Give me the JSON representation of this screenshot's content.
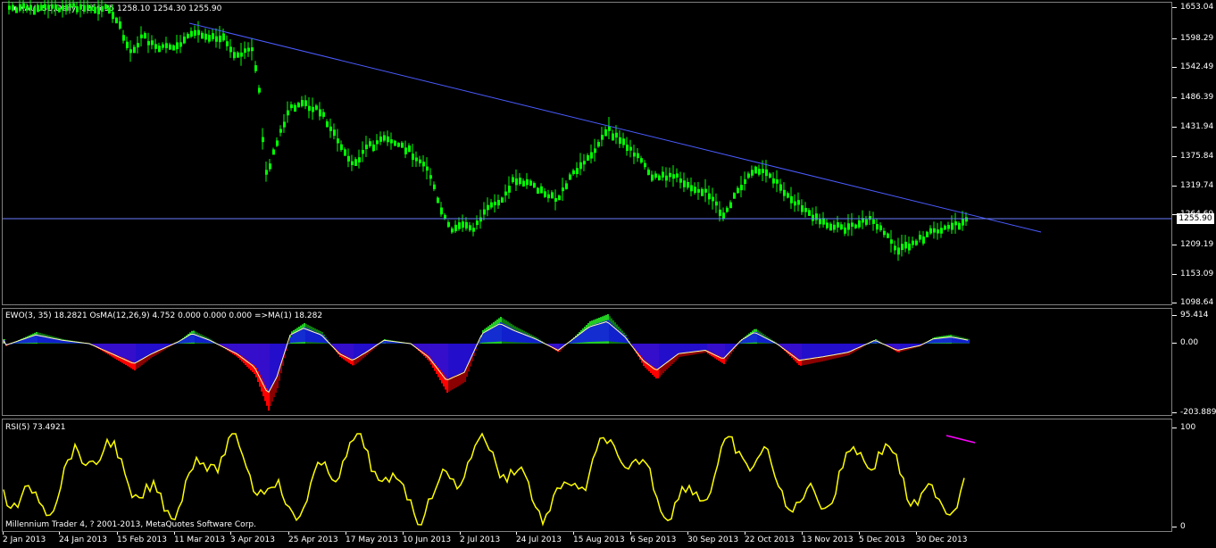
{
  "main_chart": {
    "title": "XAUUSD,Daily",
    "ohlc": "1256.35 1258.10 1254.30 1255.90",
    "current_price": "1255.90",
    "price_ticks": [
      "1653.04",
      "1598.29",
      "1542.49",
      "1486.39",
      "1431.94",
      "1375.84",
      "1319.74",
      "1264.69",
      "1209.19",
      "1153.09",
      "1098.64"
    ],
    "colors": {
      "candle": "#00ff00",
      "trendline": "#4a5bff",
      "hline": "#6a7dff"
    }
  },
  "ewo_pane": {
    "label": "EWO(3, 35) 18.2821  OsMA(12,26,9) 4.752 0.000 0.000 0.000  =>MA(1) 18.282",
    "ticks": [
      "95.414",
      "0.00",
      "-203.8899"
    ],
    "colors": {
      "green_bright": "#22cc22",
      "green_dark": "#0e7a0e",
      "red_bright": "#ff0000",
      "red_dark": "#8b0000",
      "osma": "#1010ee",
      "signal": "#ffffaa"
    }
  },
  "rsi_pane": {
    "label": "RSI(5) 73.4921",
    "ticks": [
      "100",
      "0"
    ],
    "colors": {
      "line": "#ffff00",
      "divergence": "#ff00ff"
    }
  },
  "copyright": "Millennium Trader 4, ? 2001-2013, MetaQuotes Software Corp.",
  "date_axis": [
    "2 Jan 2013",
    "24 Jan 2013",
    "15 Feb 2013",
    "11 Mar 2013",
    "3 Apr 2013",
    "25 Apr 2013",
    "17 May 2013",
    "10 Jun 2013",
    "2 Jul 2013",
    "24 Jul 2013",
    "15 Aug 2013",
    "6 Sep 2013",
    "30 Sep 2013",
    "22 Oct 2013",
    "13 Nov 2013",
    "5 Dec 2013",
    "30 Dec 2013"
  ]
}
